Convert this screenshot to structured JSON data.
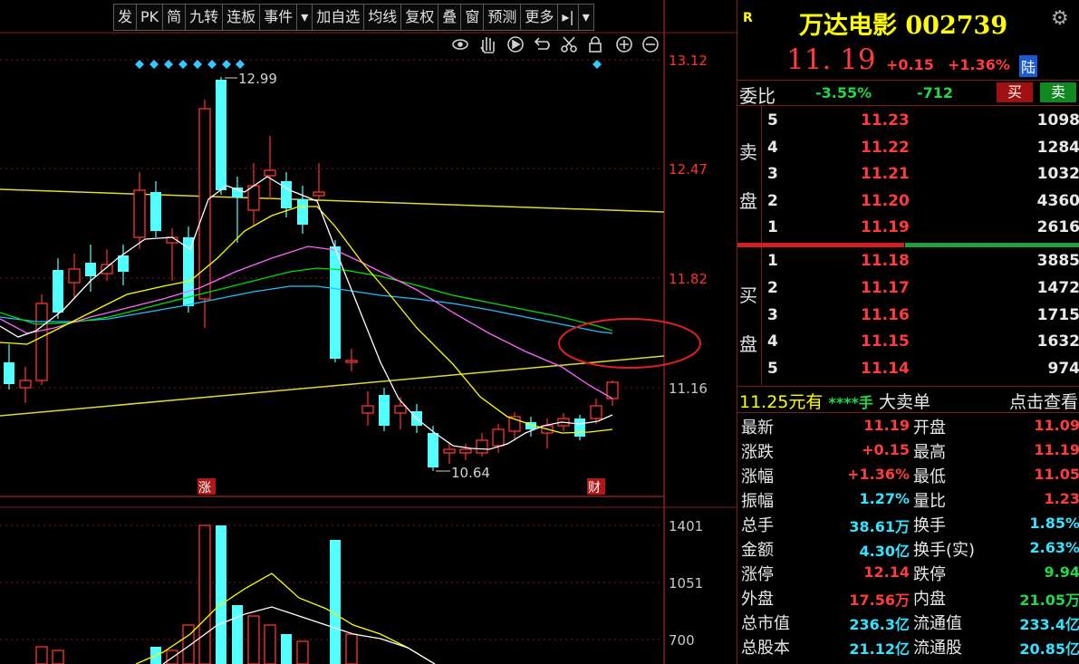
{
  "toolbar": {
    "items": [
      "发",
      "PK",
      "简",
      "九转",
      "连板",
      "事件",
      "▾",
      "加自选",
      "均线",
      "复权",
      "叠",
      "窗",
      "预测",
      "更多",
      "▸|",
      "▾"
    ]
  },
  "chart_icons": [
    "eye-icon",
    "hand-icon",
    "play-icon",
    "undo-icon",
    "scissors-icon",
    "lock-icon",
    "zoom-in-icon",
    "zoom-out-icon"
  ],
  "chart_data": {
    "type": "candlestick",
    "price_axis": {
      "ticks": [
        "13.12",
        "12.47",
        "11.82",
        "11.16"
      ]
    },
    "volume_axis": {
      "ticks": [
        "1401",
        "1051",
        "700"
      ]
    },
    "high_label": "12.99",
    "low_label": "10.64",
    "markers": [
      "涨",
      "财"
    ]
  },
  "stock": {
    "badge": "R",
    "title": "万达电影 002739",
    "price": "11. 19",
    "change": "+0.15",
    "change_pct": "+1.36%",
    "exchange": "陆"
  },
  "weibi": {
    "label": "委比",
    "ratio": "-3.55%",
    "diff": "-712",
    "buy_btn": "买",
    "sell_btn": "卖"
  },
  "sell_side_label": [
    "卖",
    "盘"
  ],
  "buy_side_label": [
    "买",
    "盘"
  ],
  "asks": [
    {
      "level": "5",
      "price": "11.23",
      "volume": "1098"
    },
    {
      "level": "4",
      "price": "11.22",
      "volume": "1284"
    },
    {
      "level": "3",
      "price": "11.21",
      "volume": "1032"
    },
    {
      "level": "2",
      "price": "11.20",
      "volume": "4360"
    },
    {
      "level": "1",
      "price": "11.19",
      "volume": "2616"
    }
  ],
  "bids": [
    {
      "level": "1",
      "price": "11.18",
      "volume": "3885"
    },
    {
      "level": "2",
      "price": "11.17",
      "volume": "1472"
    },
    {
      "level": "3",
      "price": "11.16",
      "volume": "1715"
    },
    {
      "level": "4",
      "price": "11.15",
      "volume": "1632"
    },
    {
      "level": "5",
      "price": "11.14",
      "volume": "974"
    }
  ],
  "big_order": {
    "price_text": "11.25元有",
    "qty": "****手",
    "label": "大卖单",
    "link": "点击查看"
  },
  "stats": [
    {
      "l1": "最新",
      "v1": "11.19",
      "c1": "red",
      "l2": "开盘",
      "v2": "11.09",
      "c2": "red"
    },
    {
      "l1": "涨跌",
      "v1": "+0.15",
      "c1": "red",
      "l2": "最高",
      "v2": "11.19",
      "c2": "red"
    },
    {
      "l1": "涨幅",
      "v1": "+1.36%",
      "c1": "red",
      "l2": "最低",
      "v2": "11.05",
      "c2": "red"
    },
    {
      "l1": "振幅",
      "v1": "1.27%",
      "c1": "cyan",
      "l2": "量比",
      "v2": "1.23",
      "c2": "red"
    },
    {
      "l1": "总手",
      "v1": "38.61万",
      "c1": "cyan",
      "l2": "换手",
      "v2": "1.85%",
      "c2": "cyan"
    },
    {
      "l1": "金额",
      "v1": "4.30亿",
      "c1": "cyan",
      "l2": "换手(实)",
      "v2": "2.63%",
      "c2": "cyan"
    },
    {
      "l1": "涨停",
      "v1": "12.14",
      "c1": "red",
      "l2": "跌停",
      "v2": "9.94",
      "c2": "green"
    },
    {
      "l1": "外盘",
      "v1": "17.56万",
      "c1": "red",
      "l2": "内盘",
      "v2": "21.05万",
      "c2": "green"
    },
    {
      "l1": "总市值",
      "v1": "236.3亿",
      "c1": "cyan",
      "l2": "流通值",
      "v2": "233.4亿",
      "c2": "cyan"
    },
    {
      "l1": "总股本",
      "v1": "21.12亿",
      "c1": "cyan",
      "l2": "流通股",
      "v2": "20.85亿",
      "c2": "cyan"
    }
  ],
  "colors": {
    "up": "#ff3232",
    "down": "#54ffff",
    "ma5": "#ffffff",
    "ma10": "#ffff00",
    "ma20": "#ff66ff",
    "ma30": "#00e000",
    "ma60": "#20c0ff",
    "circle": "#e02020",
    "grid": "#8a1c1c"
  }
}
